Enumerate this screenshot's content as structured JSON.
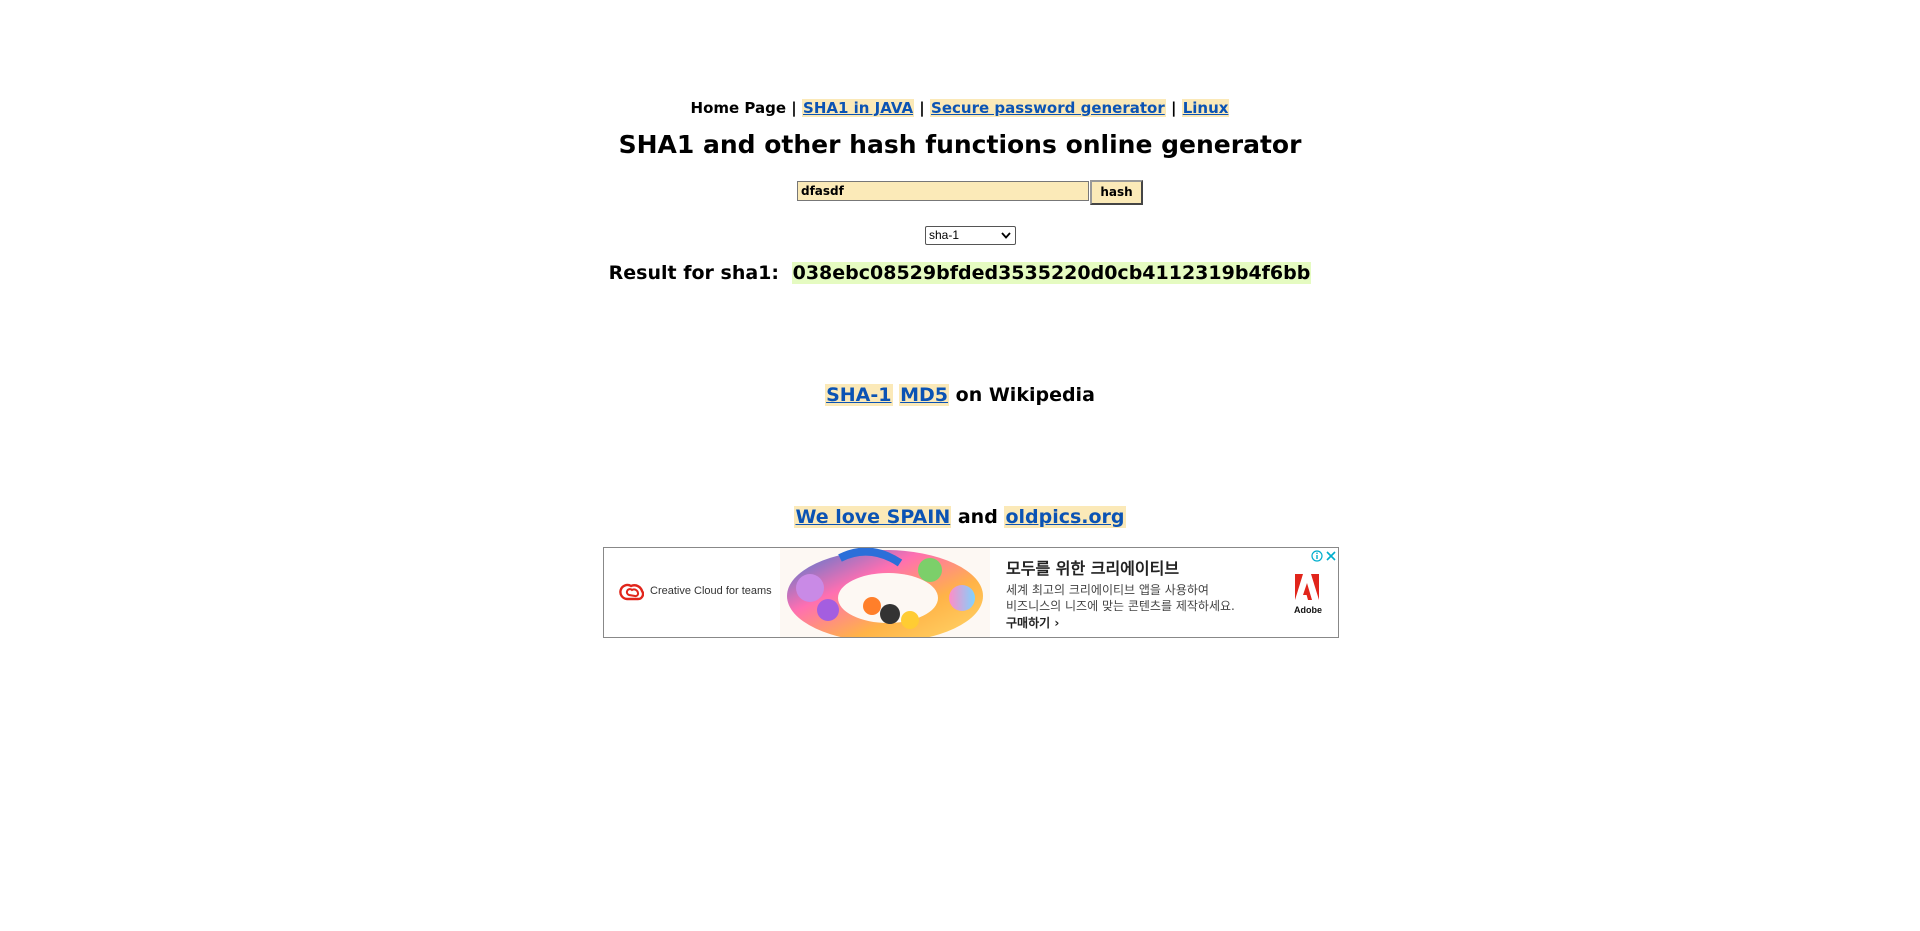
{
  "nav": {
    "home": "Home Page",
    "sep": "|",
    "links": [
      "SHA1 in JAVA",
      "Secure password generator",
      "Linux"
    ]
  },
  "title": "SHA1 and other hash functions online generator",
  "form": {
    "input_value": "dfasdf",
    "button_label": "hash",
    "select_value": "sha-1"
  },
  "result": {
    "label": "Result for sha1:",
    "value": "038ebc08529bfded3535220d0cb4112319b4f6bb"
  },
  "wiki": {
    "links": [
      "SHA-1",
      "MD5"
    ],
    "suffix": "on Wikipedia"
  },
  "promo": {
    "link1": "We love SPAIN",
    "conj": "and",
    "link2": "oldpics.org"
  },
  "ad": {
    "brand": "Creative Cloud for teams",
    "headline": "모두를 위한 크리에이티브",
    "body_line1": "세계 최고의 크리에이티브 앱을 사용하여",
    "body_line2": "비즈니스의 니즈에 맞는 콘텐츠를 제작하세요.",
    "cta": "구매하기 ›",
    "advertiser": "Adobe",
    "colors": {
      "adobe_red": "#e1251b"
    }
  }
}
